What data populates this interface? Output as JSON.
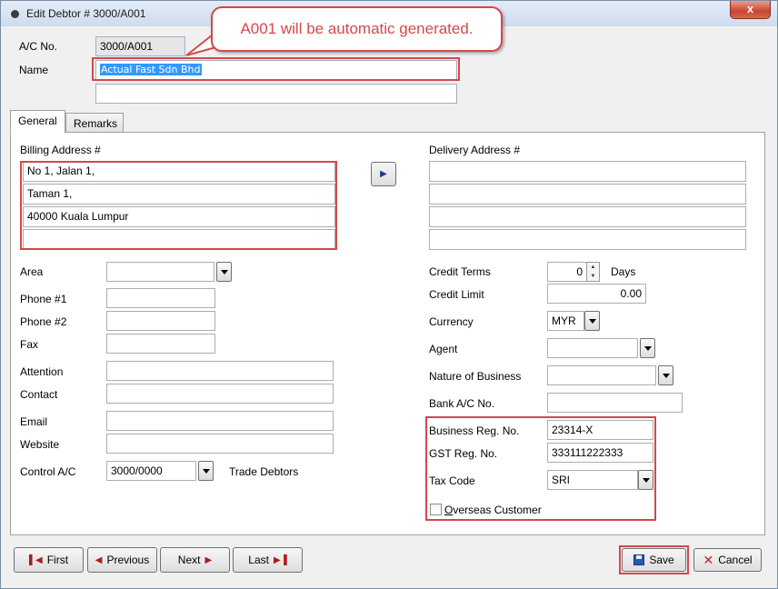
{
  "window": {
    "title": "Edit Debtor # 3000/A001",
    "close_label": "x"
  },
  "callout": {
    "text": "A001 will be automatic generated."
  },
  "header": {
    "ac_no_label": "A/C No.",
    "ac_no_value": "3000/A001",
    "name_label": "Name",
    "name_value": "Actual Fast Sdn Bhd",
    "name2_value": ""
  },
  "tabs": [
    {
      "label": "General"
    },
    {
      "label": "Remarks"
    }
  ],
  "billing": {
    "label": "Billing Address #",
    "lines": [
      "No 1, Jalan 1,",
      "Taman 1,",
      "40000 Kuala Lumpur",
      ""
    ]
  },
  "delivery": {
    "label": "Delivery Address #",
    "lines": [
      "",
      "",
      "",
      ""
    ]
  },
  "left_fields": {
    "area_label": "Area",
    "area_value": "",
    "phone1_label": "Phone #1",
    "phone1_value": "",
    "phone2_label": "Phone #2",
    "phone2_value": "",
    "fax_label": "Fax",
    "fax_value": "",
    "attention_label": "Attention",
    "attention_value": "",
    "contact_label": "Contact",
    "contact_value": "",
    "email_label": "Email",
    "email_value": "",
    "website_label": "Website",
    "website_value": "",
    "control_label": "Control A/C",
    "control_value": "3000/0000",
    "control_desc": "Trade Debtors"
  },
  "right_fields": {
    "credit_terms_label": "Credit Terms",
    "credit_terms_value": "0",
    "credit_terms_unit": "Days",
    "credit_limit_label": "Credit Limit",
    "credit_limit_value": "0.00",
    "currency_label": "Currency",
    "currency_value": "MYR",
    "agent_label": "Agent",
    "agent_value": "",
    "nature_label": "Nature of Business",
    "nature_value": "",
    "bank_label": "Bank A/C No.",
    "bank_value": "",
    "biz_reg_label": "Business Reg. No.",
    "biz_reg_value": "23314-X",
    "gst_label": "GST Reg. No.",
    "gst_value": "333111222333",
    "tax_label": "Tax Code",
    "tax_value": "SRI",
    "overseas_label": "Overseas Customer"
  },
  "footer": {
    "first_label": "First",
    "previous_label": "Previous",
    "next_label": "Next",
    "last_label": "Last",
    "save_label": "Save",
    "cancel_label": "Cancel"
  },
  "colors": {
    "highlight_red": "#d5484a",
    "selection_blue": "#3399ff",
    "title_bar": "#d6e2f1"
  }
}
